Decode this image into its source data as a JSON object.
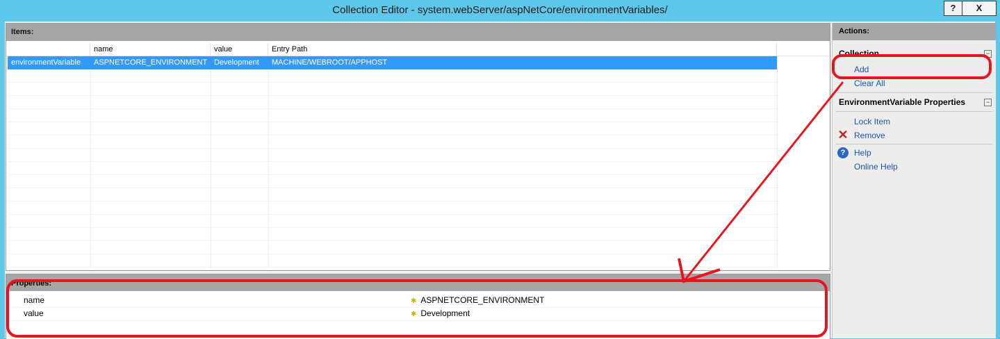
{
  "window": {
    "title": "Collection Editor - system.webServer/aspNetCore/environmentVariables/",
    "help_button": "?",
    "close_button": "X"
  },
  "items": {
    "header": "Items:",
    "columns": [
      "",
      "name",
      "value",
      "Entry Path"
    ],
    "rows": [
      {
        "type": "environmentVariable",
        "name": "ASPNETCORE_ENVIRONMENT",
        "value": "Development",
        "entry_path": "MACHINE/WEBROOT/APPHOST"
      }
    ]
  },
  "properties": {
    "header": "Properties:",
    "rows": [
      {
        "name": "name",
        "value": "ASPNETCORE_ENVIRONMENT"
      },
      {
        "name": "value",
        "value": "Development"
      }
    ]
  },
  "actions": {
    "header": "Actions:",
    "collection_group": {
      "title": "Collection",
      "items": [
        "Add",
        "Clear All"
      ]
    },
    "props_group": {
      "title": "EnvironmentVariable Properties",
      "items": [
        "Lock Item",
        "Remove"
      ]
    },
    "help_items": [
      "Help",
      "Online Help"
    ]
  },
  "colors": {
    "titlebar": "#5ec8ea",
    "selection": "#3399ff",
    "annotation": "#e8151e",
    "link": "#1b55b0"
  }
}
